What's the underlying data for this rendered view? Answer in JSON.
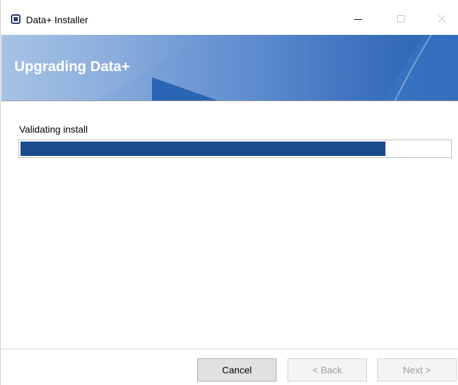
{
  "window": {
    "title": "Data+ Installer",
    "app_icon": "installer-app-icon",
    "controls": {
      "minimize_icon": "minimize-icon",
      "maximize_icon": "maximize-icon",
      "close_icon": "close-icon"
    }
  },
  "banner": {
    "heading": "Upgrading Data+",
    "accent_color": "#2a62b2"
  },
  "progress": {
    "status": "Validating install",
    "value_percent": 85,
    "fill_color": "#1b4a8d"
  },
  "footer": {
    "cancel_label": "Cancel",
    "back_label": "< Back",
    "next_label": "Next >",
    "back_enabled": false,
    "next_enabled": false
  }
}
